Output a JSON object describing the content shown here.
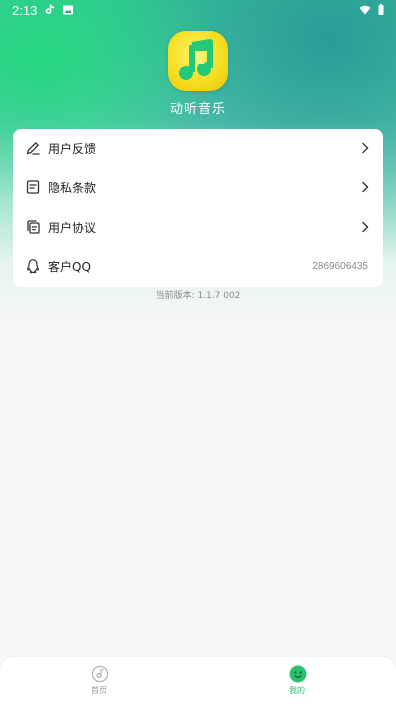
{
  "status_bar": {
    "time": "2:13"
  },
  "app": {
    "name": "动听音乐"
  },
  "menu": {
    "items": [
      {
        "label": "用户反馈",
        "icon": "edit-icon"
      },
      {
        "label": "隐私条款",
        "icon": "document-icon"
      },
      {
        "label": "用户协议",
        "icon": "copy-icon"
      },
      {
        "label": "客户QQ",
        "icon": "qq-icon",
        "value": "2869606435"
      }
    ]
  },
  "version": {
    "text": "当前版本: 1.1.7 002"
  },
  "tabs": [
    {
      "label": "首页",
      "icon": "music-disc-icon",
      "active": false
    },
    {
      "label": "我的",
      "icon": "profile-face-icon",
      "active": true
    }
  ],
  "colors": {
    "accent": "#2ac070",
    "inactive_tab": "#aaaaaa",
    "logo_yellow": "#f5dc1e",
    "logo_green": "#23c978"
  }
}
